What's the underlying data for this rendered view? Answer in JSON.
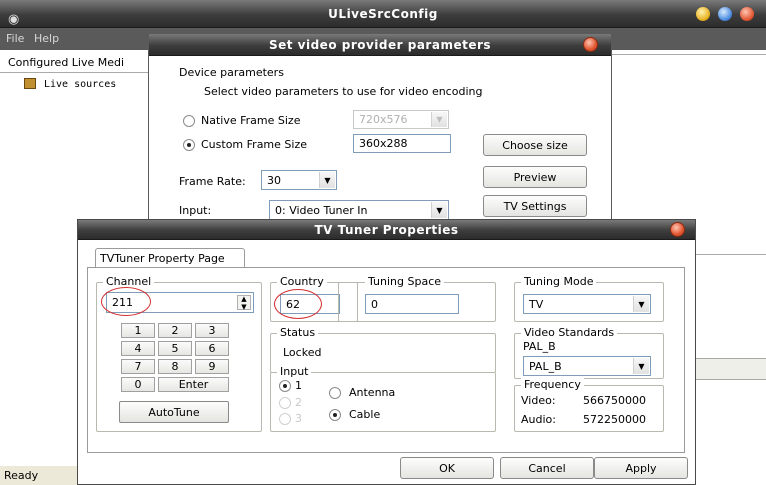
{
  "main_window": {
    "title": "ULiveSrcConfig",
    "menu": [
      "File",
      "Help"
    ],
    "tree_header": "Configured Live Medi",
    "tree_item": "Live sources",
    "status": "Ready"
  },
  "video_dialog": {
    "title": "Set video provider parameters",
    "group_label": "Device parameters",
    "description": "Select video parameters to use for video encoding",
    "native_frame_size": {
      "label": "Native Frame Size",
      "value": "720x576",
      "selected": false
    },
    "custom_frame_size": {
      "label": "Custom Frame Size",
      "value": "360x288",
      "selected": true
    },
    "choose_size_button": "Choose size",
    "frame_rate": {
      "label": "Frame Rate:",
      "value": "30"
    },
    "preview_button": "Preview",
    "input": {
      "label": "Input:",
      "value": "0: Video Tuner In"
    },
    "tv_settings_button": "TV Settings"
  },
  "tuner_dialog": {
    "title": "TV Tuner Properties",
    "tab_label": "TVTuner Property Page",
    "channel": {
      "label": "Channel",
      "value": "211",
      "keypad": [
        "1",
        "2",
        "3",
        "4",
        "5",
        "6",
        "7",
        "8",
        "9",
        "0"
      ],
      "enter_label": "Enter",
      "autotune_label": "AutoTune"
    },
    "country": {
      "label": "Country",
      "value": "62"
    },
    "tuning_space": {
      "label": "Tuning Space",
      "value": "0"
    },
    "tuning_mode": {
      "label": "Tuning Mode",
      "value": "TV"
    },
    "status": {
      "label": "Status",
      "value": "Locked"
    },
    "video_standards": {
      "label": "Video Standards",
      "current": "PAL_B",
      "selected": "PAL_B"
    },
    "input": {
      "label": "Input",
      "numbers": [
        "1",
        "2",
        "3"
      ],
      "selected_number": "1",
      "antenna_label": "Antenna",
      "cable_label": "Cable",
      "selected_source": "Cable"
    },
    "frequency": {
      "label": "Frequency",
      "video_label": "Video:",
      "video_value": "566750000",
      "audio_label": "Audio:",
      "audio_value": "572250000"
    },
    "buttons": {
      "ok": "OK",
      "cancel": "Cancel",
      "apply": "Apply"
    }
  },
  "colors": {
    "highlight_circle": "#d23030",
    "title_bar": "#3d3d3d"
  }
}
